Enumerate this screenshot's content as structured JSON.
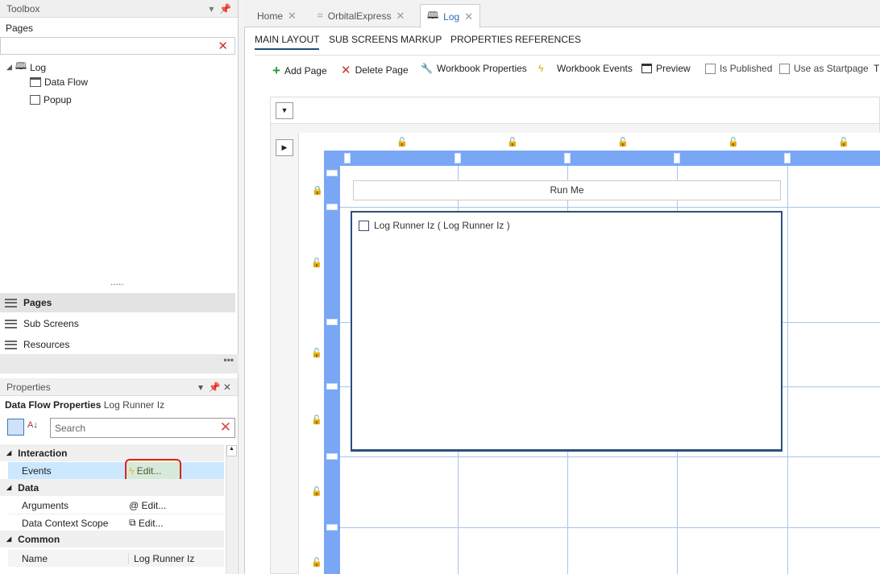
{
  "toolbox": {
    "title": "Toolbox",
    "pages_label": "Pages"
  },
  "tree": [
    {
      "label": "Log",
      "icon": "book-icon"
    },
    {
      "label": "Data Flow",
      "icon": "dataflow-icon"
    },
    {
      "label": "Popup",
      "icon": "popup-icon"
    }
  ],
  "nav": [
    {
      "label": "Pages"
    },
    {
      "label": "Sub Screens"
    },
    {
      "label": "Resources"
    }
  ],
  "properties": {
    "title": "Properties",
    "header_bold": "Data Flow Properties",
    "header_name": "Log Runner Iz",
    "search_placeholder": "Search",
    "groups": [
      {
        "label": "Interaction",
        "rows": [
          {
            "name": "Events",
            "value": "Edit...",
            "icon": "lightning-icon",
            "selected": true
          }
        ]
      },
      {
        "label": "Data",
        "rows": [
          {
            "name": "Arguments",
            "value": "Edit...",
            "icon": "arguments-icon"
          },
          {
            "name": "Data Context Scope",
            "value": "Edit...",
            "icon": "scope-icon"
          }
        ]
      },
      {
        "label": "Common",
        "rows": [
          {
            "name": "Name",
            "value": "Log Runner Iz"
          }
        ]
      }
    ]
  },
  "tabs": [
    {
      "label": "Home"
    },
    {
      "label": "OrbitalExpress"
    },
    {
      "label": "Log",
      "active": true
    }
  ],
  "subtabs": [
    "MAIN LAYOUT",
    "SUB SCREENS",
    "MARKUP",
    "PROPERTIES",
    "REFERENCES"
  ],
  "toolbar": {
    "add_page": "Add Page",
    "delete_page": "Delete Page",
    "workbook_properties": "Workbook Properties",
    "workbook_events": "Workbook Events",
    "preview": "Preview",
    "is_published": "Is Published",
    "use_as_startpage": "Use as Startpage",
    "overflow": "T"
  },
  "designer": {
    "button_label": "Run Me",
    "component_label": "Log Runner Iz ( Log Runner Iz )"
  },
  "colors": {
    "accent": "#7aa7f5",
    "highlight": "#cce8ff",
    "red": "#e02020"
  }
}
